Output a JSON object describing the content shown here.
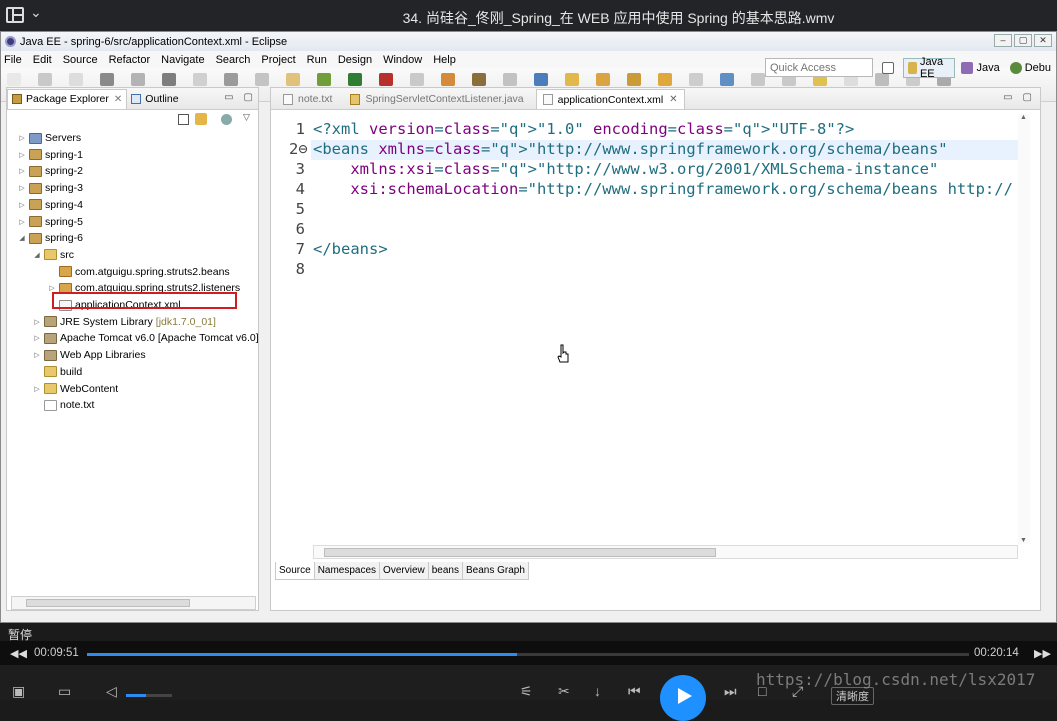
{
  "player": {
    "title": "34. 尚硅谷_佟刚_Spring_在 WEB 应用中使用 Spring 的基本思路.wmv",
    "state": "暂停",
    "current_time": "00:09:51",
    "total_time": "00:20:14",
    "progress": 0.487,
    "clarity": "清晰度",
    "watermark": "https://blog.csdn.net/lsx2017"
  },
  "window": {
    "title": "Java EE - spring-6/src/applicationContext.xml - Eclipse"
  },
  "menu": [
    "File",
    "Edit",
    "Source",
    "Refactor",
    "Navigate",
    "Search",
    "Project",
    "Run",
    "Design",
    "Window",
    "Help"
  ],
  "quick_access": {
    "placeholder": "Quick Access"
  },
  "perspectives": [
    {
      "label": "Java EE",
      "active": true
    },
    {
      "label": "Java",
      "active": false
    },
    {
      "label": "Debu",
      "active": false
    }
  ],
  "explorer": {
    "tabs": [
      {
        "label": "Package Explorer",
        "active": true
      },
      {
        "label": "Outline",
        "active": false
      }
    ],
    "tree": [
      {
        "label": "Servers",
        "level": 0,
        "type": "srv",
        "twisty": "▷"
      },
      {
        "label": "spring-1",
        "level": 0,
        "type": "proj",
        "twisty": "▷"
      },
      {
        "label": "spring-2",
        "level": 0,
        "type": "proj",
        "twisty": "▷"
      },
      {
        "label": "spring-3",
        "level": 0,
        "type": "proj",
        "twisty": "▷"
      },
      {
        "label": "spring-4",
        "level": 0,
        "type": "proj",
        "twisty": "▷"
      },
      {
        "label": "spring-5",
        "level": 0,
        "type": "proj",
        "twisty": "▷"
      },
      {
        "label": "spring-6",
        "level": 0,
        "type": "proj",
        "twisty": "◢"
      },
      {
        "label": "src",
        "level": 1,
        "type": "fold",
        "twisty": "◢"
      },
      {
        "label": "com.atguigu.spring.struts2.beans",
        "level": 2,
        "type": "pkg",
        "twisty": ""
      },
      {
        "label": "com.atguigu.spring.struts2.listeners",
        "level": 2,
        "type": "pkg",
        "twisty": "▷"
      },
      {
        "label": "applicationContext.xml",
        "level": 2,
        "type": "xmlf",
        "twisty": ""
      },
      {
        "label": "JRE System Library",
        "extra": "[jdk1.7.0_01]",
        "level": 1,
        "type": "lib",
        "twisty": "▷"
      },
      {
        "label": "Apache Tomcat v6.0 [Apache Tomcat v6.0]",
        "level": 1,
        "type": "lib",
        "twisty": "▷"
      },
      {
        "label": "Web App Libraries",
        "level": 1,
        "type": "lib",
        "twisty": "▷"
      },
      {
        "label": "build",
        "level": 1,
        "type": "fold",
        "twisty": ""
      },
      {
        "label": "WebContent",
        "level": 1,
        "type": "fold",
        "twisty": "▷"
      },
      {
        "label": "note.txt",
        "level": 1,
        "type": "txtf",
        "twisty": ""
      }
    ]
  },
  "editor": {
    "tabs": [
      {
        "label": "note.txt",
        "active": false
      },
      {
        "label": "SpringServletContextListener.java",
        "active": false
      },
      {
        "label": "applicationContext.xml",
        "active": true
      }
    ],
    "lines": [
      {
        "num": "1",
        "text": "<?xml version=\"1.0\" encoding=\"UTF-8\"?>"
      },
      {
        "num": "2⊖",
        "text": "<beans xmlns=\"http://www.springframework.org/schema/beans\""
      },
      {
        "num": "3",
        "text": "    xmlns:xsi=\"http://www.w3.org/2001/XMLSchema-instance\""
      },
      {
        "num": "4",
        "text": "    xsi:schemaLocation=\"http://www.springframework.org/schema/beans http://"
      },
      {
        "num": "5",
        "text": ""
      },
      {
        "num": "6",
        "text": ""
      },
      {
        "num": "7",
        "text": "</beans>"
      },
      {
        "num": "8",
        "text": ""
      }
    ],
    "bottom_tabs": [
      "Source",
      "Namespaces",
      "Overview",
      "beans",
      "Beans Graph"
    ]
  },
  "colors": {
    "accent": "#2d8cf0",
    "highlight_box": "#d21c22",
    "xml_tag": "#1f6e80",
    "xml_value": "#1d1fb8"
  }
}
